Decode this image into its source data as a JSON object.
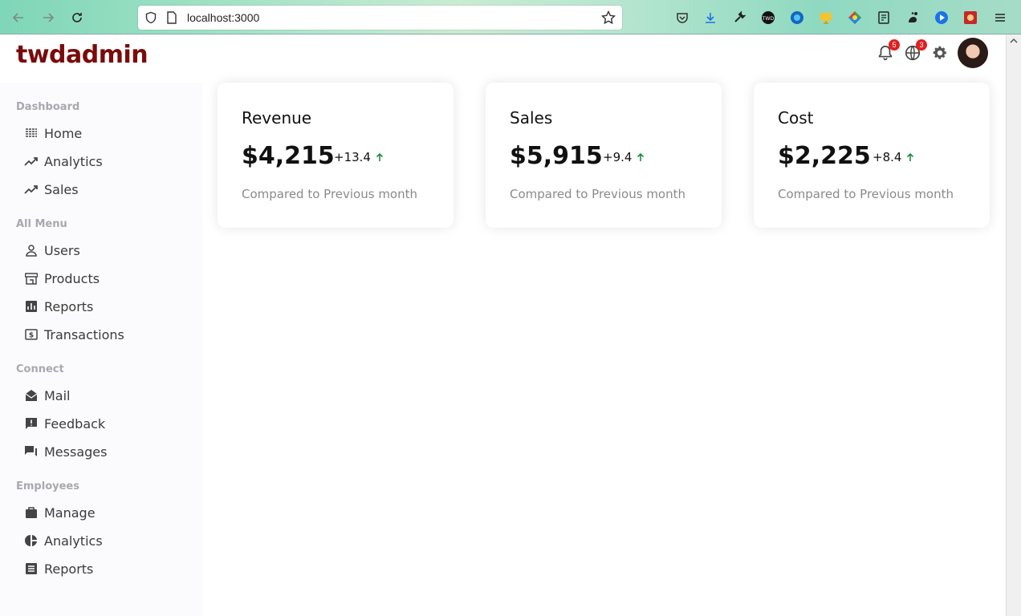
{
  "browser": {
    "url": "localhost:3000"
  },
  "app": {
    "logo": "twdadmin",
    "notifications_count": "5",
    "language_count": "3"
  },
  "sidebar": {
    "sections": [
      {
        "title": "Dashboard",
        "items": [
          {
            "label": "Home",
            "icon": "home-icon"
          },
          {
            "label": "Analytics",
            "icon": "trending-up-icon"
          },
          {
            "label": "Sales",
            "icon": "trending-up-icon"
          }
        ]
      },
      {
        "title": "All Menu",
        "items": [
          {
            "label": "Users",
            "icon": "user-icon"
          },
          {
            "label": "Products",
            "icon": "storefront-icon"
          },
          {
            "label": "Reports",
            "icon": "bar-chart-icon"
          },
          {
            "label": "Transactions",
            "icon": "money-icon"
          }
        ]
      },
      {
        "title": "Connect",
        "items": [
          {
            "label": "Mail",
            "icon": "mail-icon"
          },
          {
            "label": "Feedback",
            "icon": "feedback-icon"
          },
          {
            "label": "Messages",
            "icon": "forum-icon"
          }
        ]
      },
      {
        "title": "Employees",
        "items": [
          {
            "label": "Manage",
            "icon": "briefcase-icon"
          },
          {
            "label": "Analytics",
            "icon": "pie-chart-icon"
          },
          {
            "label": "Reports",
            "icon": "report-icon"
          }
        ]
      }
    ]
  },
  "cards": [
    {
      "title": "Revenue",
      "value": "$4,215",
      "rate": "+13.4",
      "subtitle": "Compared to Previous month"
    },
    {
      "title": "Sales",
      "value": "$5,915",
      "rate": "+9.4",
      "subtitle": "Compared to Previous month"
    },
    {
      "title": "Cost",
      "value": "$2,225",
      "rate": "+8.4",
      "subtitle": "Compared to Previous month"
    }
  ],
  "colors": {
    "brand": "#7a0b0b",
    "positive": "#1e8e3e",
    "badge": "#e02020"
  }
}
